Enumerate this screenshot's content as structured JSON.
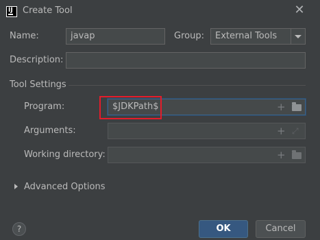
{
  "window": {
    "title": "Create Tool",
    "app_icon_text": "IJ"
  },
  "form": {
    "name_label": "Name:",
    "name_value": "javap",
    "group_label": "Group:",
    "group_value": "External Tools",
    "description_label": "Description:",
    "description_value": ""
  },
  "tool_settings": {
    "heading": "Tool Settings",
    "program_label": "Program:",
    "program_value": "$JDKPath$",
    "arguments_label": "Arguments:",
    "arguments_value": "",
    "working_dir_label": "Working directory:",
    "working_dir_value": ""
  },
  "advanced": {
    "label": "Advanced Options",
    "expanded": false
  },
  "buttons": {
    "help": "?",
    "ok": "OK",
    "cancel": "Cancel"
  },
  "icons": {
    "add": "+",
    "expand": "⤢",
    "close": "✕"
  },
  "colors": {
    "background": "#3c3f41",
    "field_bg": "#45494a",
    "focus_border": "#3d6185",
    "highlight": "#e41c2b",
    "ok_button": "#365880"
  }
}
